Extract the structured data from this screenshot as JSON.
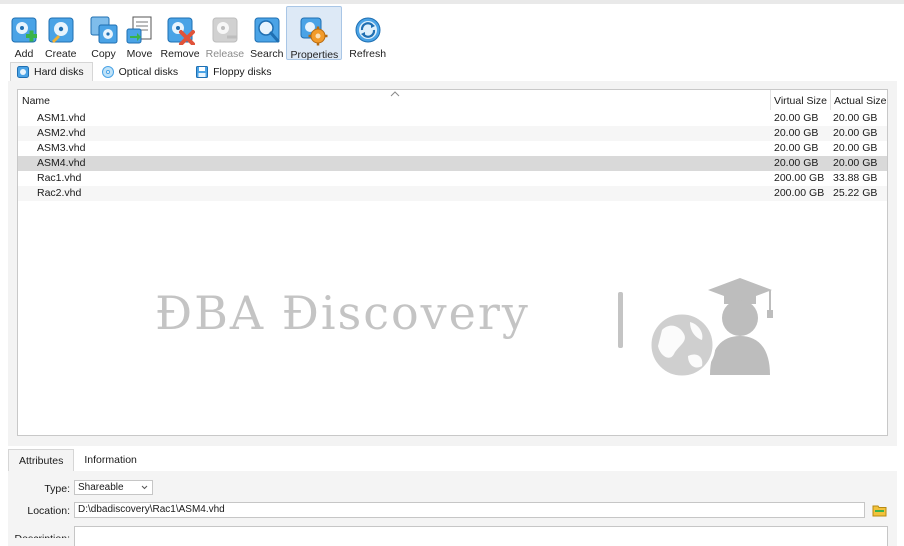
{
  "toolbar": {
    "items": [
      {
        "key": "add",
        "label": "Add",
        "icon": "add-disk-icon"
      },
      {
        "key": "create",
        "label": "Create",
        "icon": "create-disk-icon"
      },
      {
        "key": "copy",
        "label": "Copy",
        "icon": "copy-disk-icon"
      },
      {
        "key": "move",
        "label": "Move",
        "icon": "move-disk-icon"
      },
      {
        "key": "remove",
        "label": "Remove",
        "icon": "remove-disk-icon"
      },
      {
        "key": "release",
        "label": "Release",
        "icon": "release-disk-icon"
      },
      {
        "key": "search",
        "label": "Search",
        "icon": "search-disk-icon"
      },
      {
        "key": "properties",
        "label": "Properties",
        "icon": "properties-gear-icon"
      },
      {
        "key": "refresh",
        "label": "Refresh",
        "icon": "refresh-icon"
      }
    ]
  },
  "disk_tabs": [
    {
      "label": "Hard disks",
      "icon": "hard-disk-icon"
    },
    {
      "label": "Optical disks",
      "icon": "optical-disk-icon"
    },
    {
      "label": "Floppy disks",
      "icon": "floppy-disk-icon"
    }
  ],
  "table": {
    "columns": [
      "Name",
      "Virtual Size",
      "Actual Size"
    ],
    "rows": [
      {
        "name": "ASM1.vhd",
        "virtual": "20.00 GB",
        "actual": "20.00 GB"
      },
      {
        "name": "ASM2.vhd",
        "virtual": "20.00 GB",
        "actual": "20.00 GB"
      },
      {
        "name": "ASM3.vhd",
        "virtual": "20.00 GB",
        "actual": "20.00 GB"
      },
      {
        "name": "ASM4.vhd",
        "virtual": "20.00 GB",
        "actual": "20.00 GB"
      },
      {
        "name": "Rac1.vhd",
        "virtual": "200.00 GB",
        "actual": "33.88 GB"
      },
      {
        "name": "Rac2.vhd",
        "virtual": "200.00 GB",
        "actual": "25.22 GB"
      }
    ],
    "selected_row": 3
  },
  "watermark": {
    "text": "ÐBA Ðiscovery"
  },
  "details": {
    "tabs": [
      "Attributes",
      "Information"
    ],
    "type_label": "Type:",
    "type_value": "Shareable",
    "location_label": "Location:",
    "location_value": "D:\\dbadiscovery\\Rac1\\ASM4.vhd",
    "description_label": "Description:"
  },
  "colors": {
    "accent": "#2f8fd8",
    "selected_row": "#d9d9d9",
    "active_button": "#dde9f6",
    "watermark": "#c4c4c4"
  }
}
